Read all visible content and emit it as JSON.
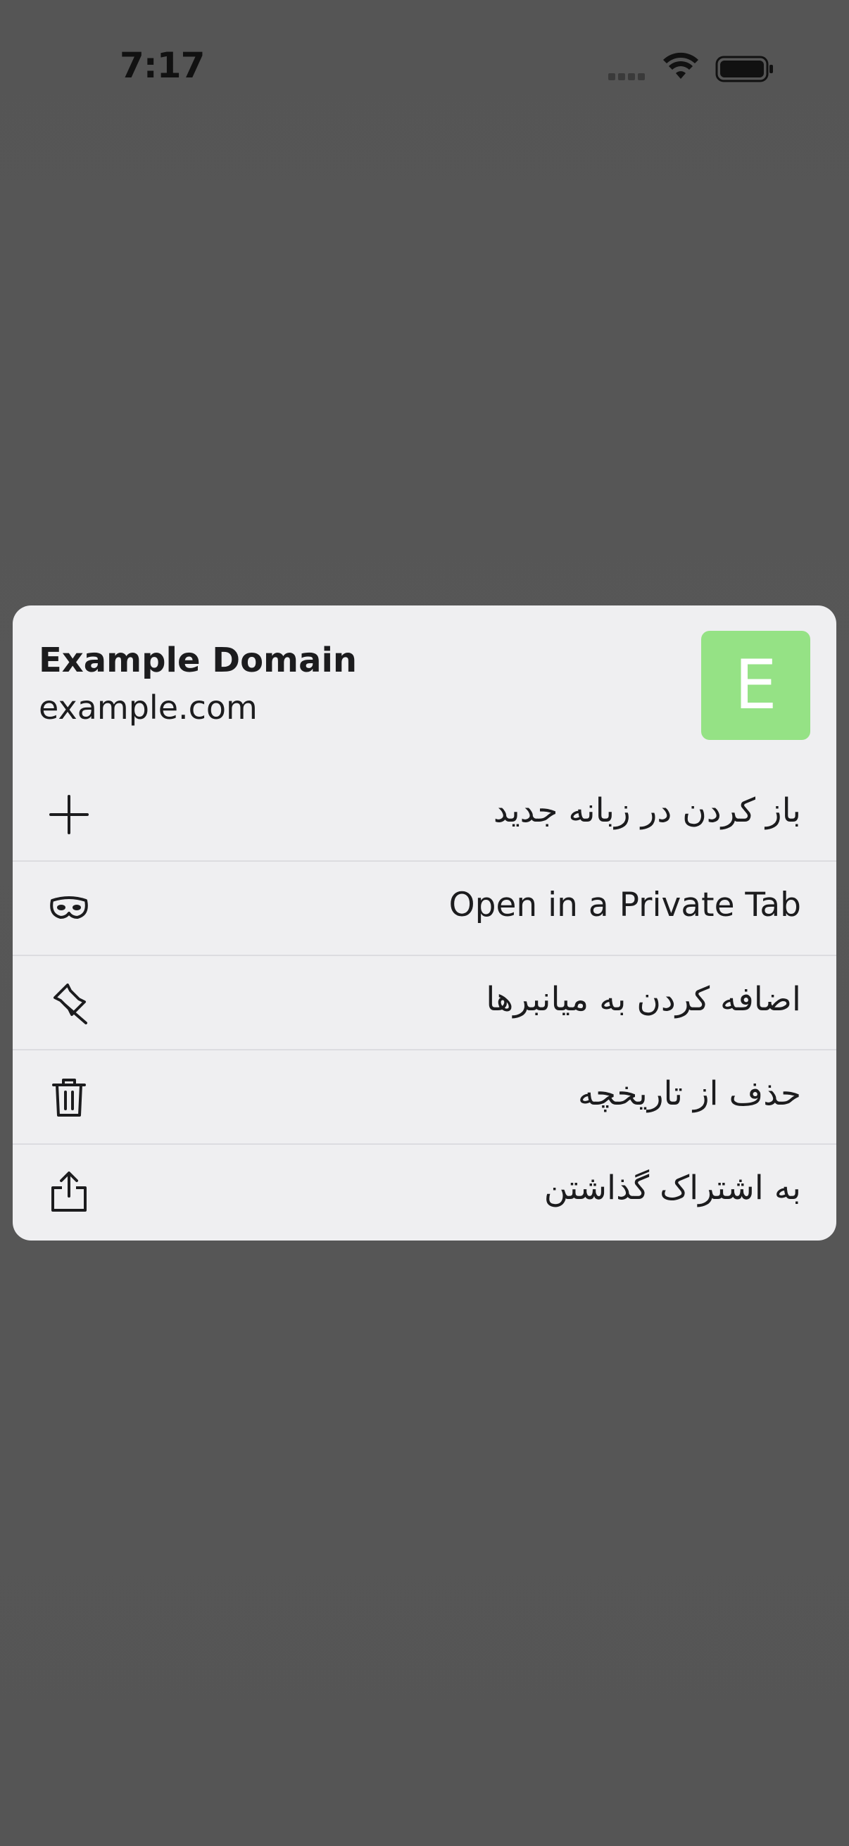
{
  "status_bar": {
    "time": "7:17",
    "icons": [
      "cellular-signal-icon",
      "wifi-icon",
      "battery-icon"
    ]
  },
  "menu": {
    "header": {
      "title": "Example Domain",
      "url": "example.com",
      "favicon_letter": "E",
      "favicon_color": "#95e285"
    },
    "items": [
      {
        "label": "باز کردن در زبانه جدید",
        "icon": "plus-icon"
      },
      {
        "label": "Open in a Private Tab",
        "icon": "private-mask-icon"
      },
      {
        "label": "اضافه کردن به میانبرها",
        "icon": "pin-icon"
      },
      {
        "label": "حذف از تاریخچه",
        "icon": "trash-icon"
      },
      {
        "label": "به اشتراک گذاشتن",
        "icon": "share-icon"
      }
    ]
  },
  "colors": {
    "backdrop": "#545454",
    "card": "#efeff1",
    "text": "#1c1c1e",
    "divider": "#dcdce0"
  }
}
